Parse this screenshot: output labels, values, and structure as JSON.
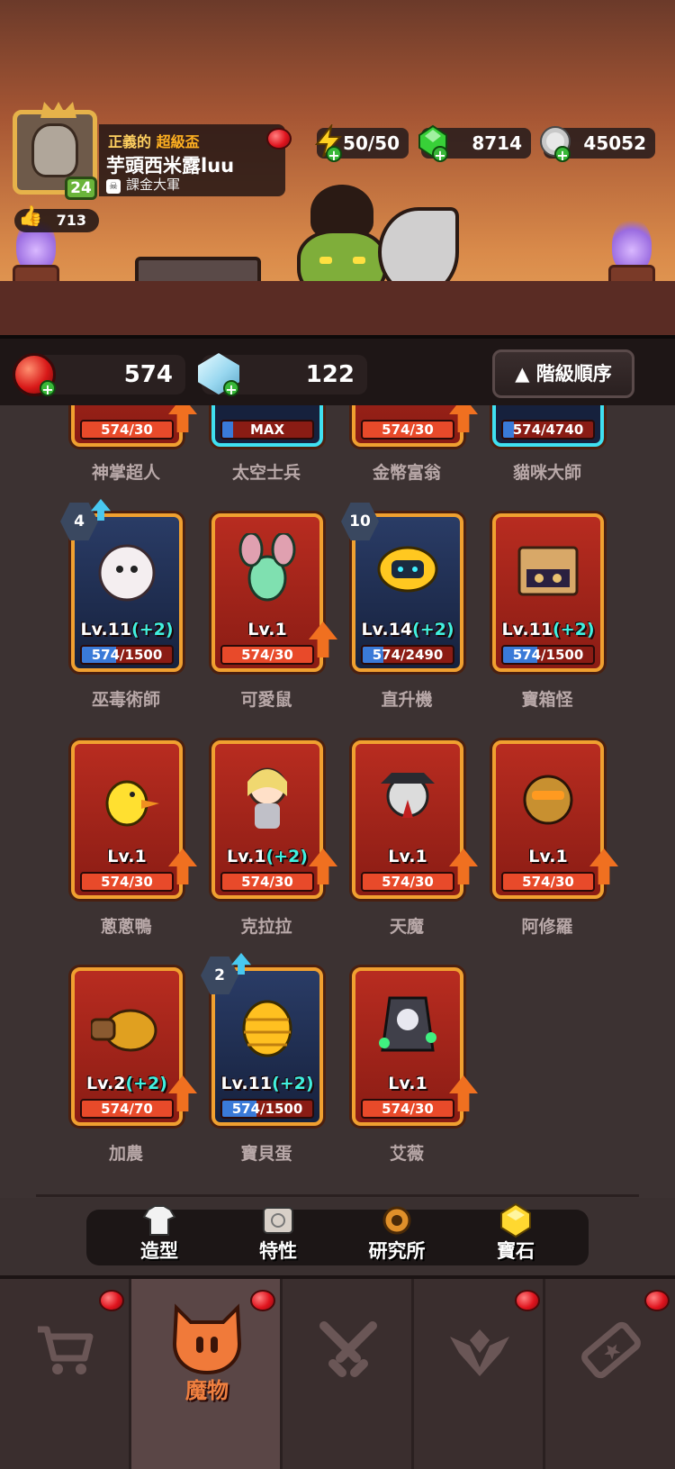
{
  "profile": {
    "title_prefix": "正義的",
    "title_highlight": "超級盃",
    "name": "芋頭西米露luu",
    "guild": "課金大軍",
    "level": "24",
    "likes": "713"
  },
  "resources": {
    "energy": "50/50",
    "green_gems": "8714",
    "silver_coins": "45052"
  },
  "currency": {
    "red_orbs": "574",
    "crystals": "122"
  },
  "sort_button": "▲ 階級順序",
  "cards_partial": [
    {
      "name": "神掌超人",
      "bar": "574/30",
      "frame": "red"
    },
    {
      "name": "太空士兵",
      "bar": "MAX",
      "frame": "cyan"
    },
    {
      "name": "金幣富翁",
      "bar": "574/30",
      "frame": "red"
    },
    {
      "name": "貓咪大師",
      "bar": "574/4740",
      "frame": "cyan"
    }
  ],
  "cards": [
    {
      "name": "巫毒術師",
      "lv": "Lv.11",
      "bonus": "(+2)",
      "bar": "574/1500",
      "fill": 0.38,
      "bar_color": "blue",
      "frame": "blue",
      "hex": "4",
      "hex_up": true
    },
    {
      "name": "可愛鼠",
      "lv": "Lv.1",
      "bonus": "",
      "bar": "574/30",
      "fill": 1.0,
      "bar_color": "red",
      "frame": "red",
      "up": true
    },
    {
      "name": "直升機",
      "lv": "Lv.14",
      "bonus": "(+2)",
      "bar": "574/2490",
      "fill": 0.23,
      "bar_color": "blue",
      "frame": "blue",
      "hex": "10"
    },
    {
      "name": "寶箱怪",
      "lv": "Lv.11",
      "bonus": "(+2)",
      "bar": "574/1500",
      "fill": 0.38,
      "bar_color": "blue",
      "frame": "red"
    },
    {
      "name": "蔥蔥鴨",
      "lv": "Lv.1",
      "bonus": "",
      "bar": "574/30",
      "fill": 1.0,
      "bar_color": "red",
      "frame": "red",
      "up": true
    },
    {
      "name": "克拉拉",
      "lv": "Lv.1",
      "bonus": "(+2)",
      "bar": "574/30",
      "fill": 1.0,
      "bar_color": "red",
      "frame": "red",
      "up": true
    },
    {
      "name": "天魔",
      "lv": "Lv.1",
      "bonus": "",
      "bar": "574/30",
      "fill": 1.0,
      "bar_color": "red",
      "frame": "red",
      "up": true
    },
    {
      "name": "阿修羅",
      "lv": "Lv.1",
      "bonus": "",
      "bar": "574/30",
      "fill": 1.0,
      "bar_color": "red",
      "frame": "red",
      "up": true
    },
    {
      "name": "加農",
      "lv": "Lv.2",
      "bonus": "(+2)",
      "bar": "574/70",
      "fill": 1.0,
      "bar_color": "red",
      "frame": "red",
      "up": true
    },
    {
      "name": "寶貝蛋",
      "lv": "Lv.11",
      "bonus": "(+2)",
      "bar": "574/1500",
      "fill": 0.38,
      "bar_color": "blue",
      "frame": "blue",
      "hex": "2",
      "hex_up": true
    },
    {
      "name": "艾薇",
      "lv": "Lv.1",
      "bonus": "",
      "bar": "574/30",
      "fill": 1.0,
      "bar_color": "red",
      "frame": "red",
      "up": true
    }
  ],
  "subtabs": [
    "造型",
    "特性",
    "研究所",
    "寶石"
  ],
  "nav": {
    "active_label": "魔物",
    "tabs": [
      "shop-cart-icon",
      "monster-icon",
      "crossed-swords-icon",
      "rank-wings-icon",
      "ticket-icon"
    ]
  }
}
